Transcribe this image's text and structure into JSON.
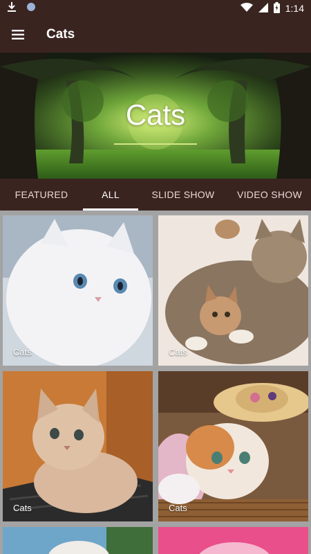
{
  "status_bar": {
    "time": "1:14",
    "icons": [
      "download-icon",
      "circle-notification-icon",
      "wifi-icon",
      "signal-icon",
      "battery-icon"
    ]
  },
  "app_bar": {
    "title": "Cats",
    "menu_icon": "hamburger-menu-icon"
  },
  "hero": {
    "title": "Cats"
  },
  "tabs": [
    {
      "label": "FEATURED",
      "active": false
    },
    {
      "label": "ALL",
      "active": true
    },
    {
      "label": "SLIDE SHOW",
      "active": false
    },
    {
      "label": "VIDEO SHOW",
      "active": false
    }
  ],
  "grid": {
    "items": [
      {
        "label": "Cats"
      },
      {
        "label": "Cats"
      },
      {
        "label": "Cats"
      },
      {
        "label": "Cats"
      },
      {
        "label": ""
      },
      {
        "label": ""
      }
    ]
  },
  "colors": {
    "toolbar": "#3a2420",
    "grid_background": "#a3a3a3",
    "tab_indicator": "#ffffff",
    "hero_underline": "#d4e68a"
  }
}
